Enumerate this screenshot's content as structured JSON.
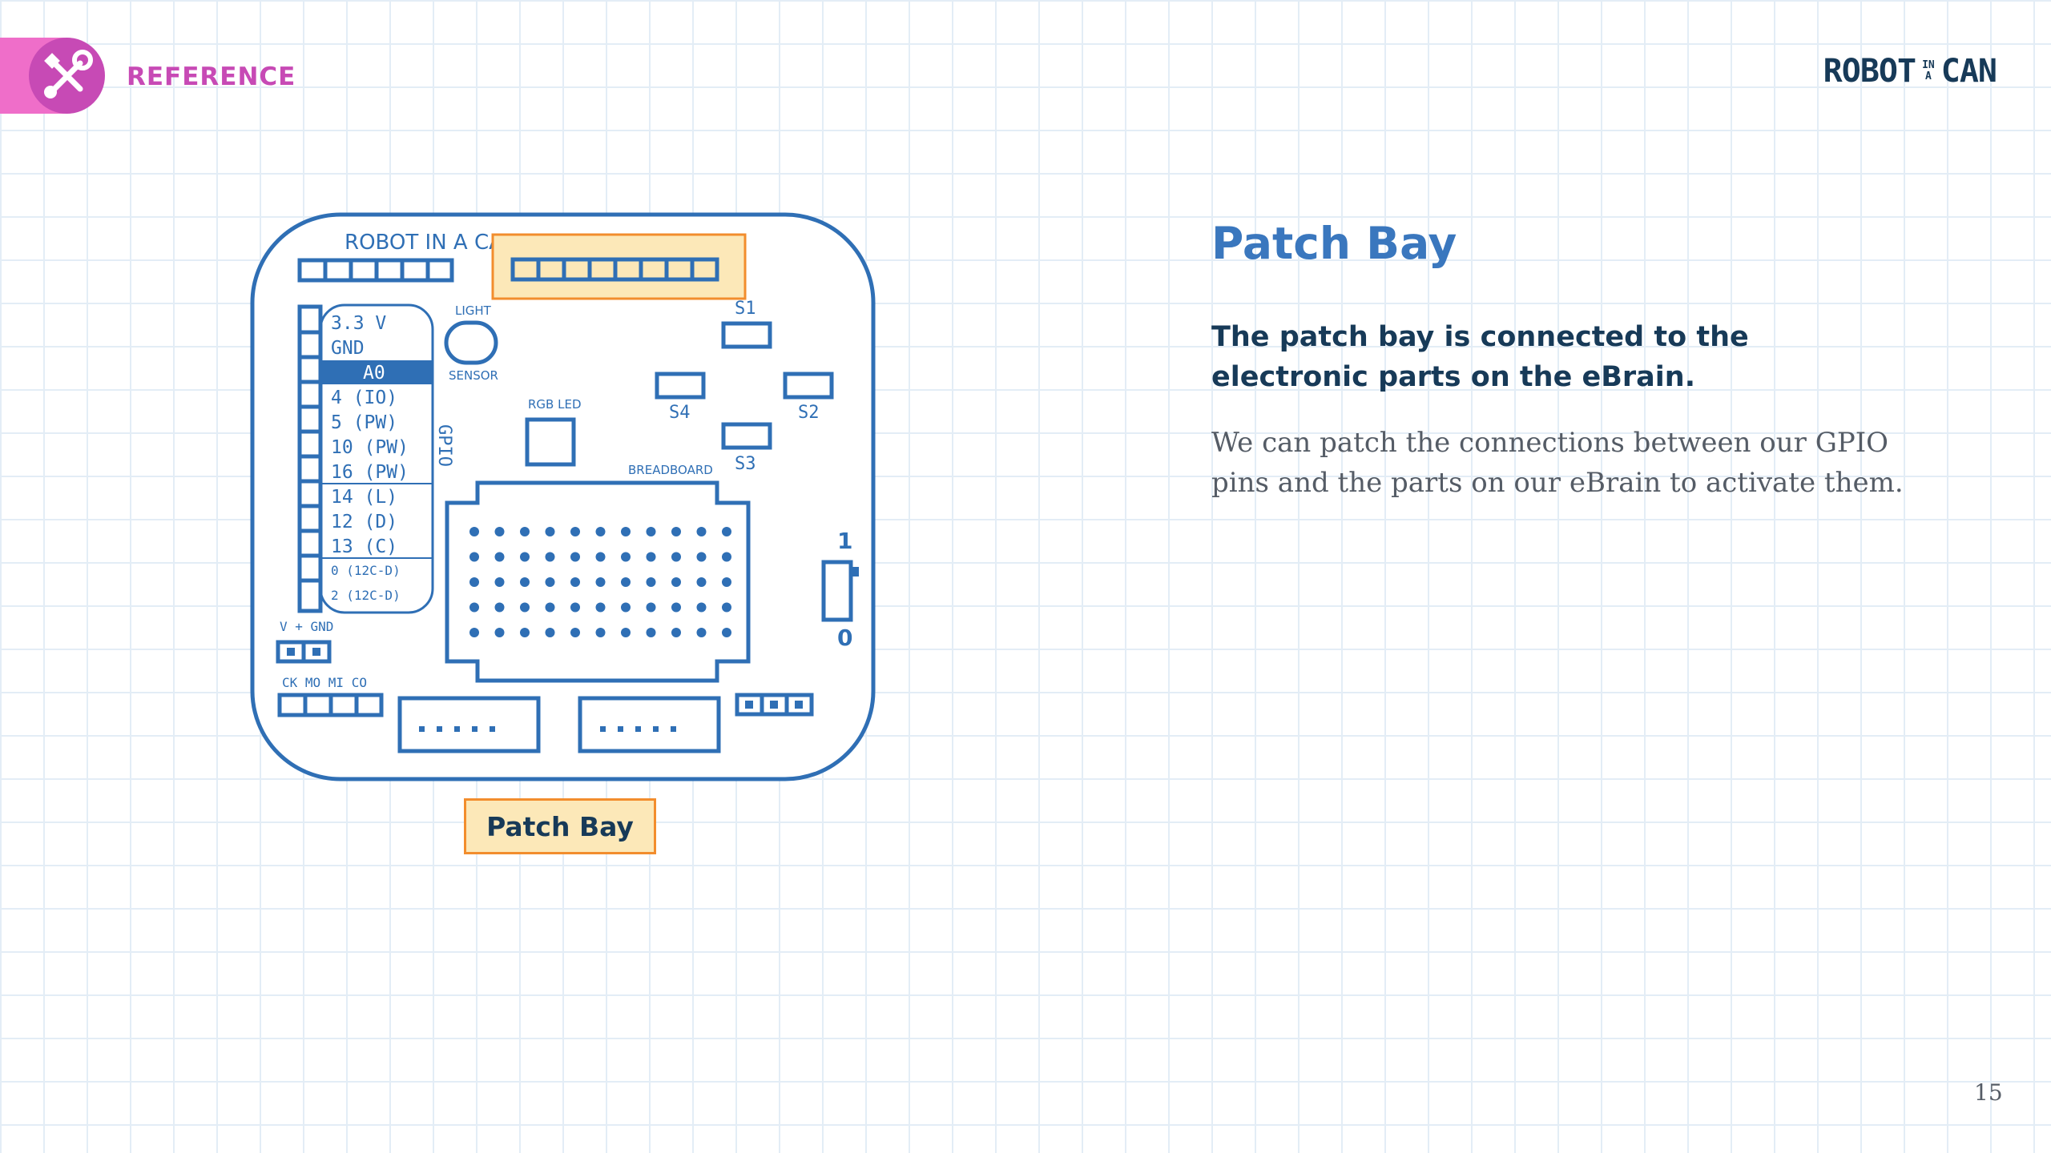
{
  "header": {
    "section_label": "REFERENCE",
    "section_icon": "tools-icon",
    "brand": {
      "word1": "ROBOT",
      "small1": "IN",
      "small2": "A",
      "word2": "CAN"
    }
  },
  "board": {
    "brand_text": "ROBOT IN A CAN",
    "pins": [
      "3.3 V",
      "GND",
      "A0",
      "4 (IO)",
      "5 (PW)",
      "10 (PW)",
      "16 (PW)",
      "14 (L)",
      "12 (D)",
      "13 (C)",
      "0 (12C-D)",
      "2 (12C-D)"
    ],
    "gpio_label": "GPIO",
    "light_label": "LIGHT",
    "sensor_label": "SENSOR",
    "rgb_label": "RGB LED",
    "breadboard_label": "BREADBOARD",
    "switches": [
      "S1",
      "S2",
      "S3",
      "S4"
    ],
    "toggle_on": "1",
    "toggle_off": "0",
    "power_label": "V + GND",
    "spi_label": "CK MO MI CO"
  },
  "highlight_label": "Patch Bay",
  "content": {
    "title": "Patch Bay",
    "lead": "The patch bay is connected to the electronic parts on the eBrain.",
    "body": "We can patch the connections between our GPIO pins and the parts on our eBrain to activate them."
  },
  "page_number": "15",
  "colors": {
    "accent_pink": "#ef6ec9",
    "accent_magenta": "#c74ab5",
    "board_blue": "#2f6fb5",
    "title_blue": "#3a77be",
    "navy": "#173a58",
    "highlight_fill": "#fce8b8",
    "highlight_border": "#f28d2d"
  }
}
